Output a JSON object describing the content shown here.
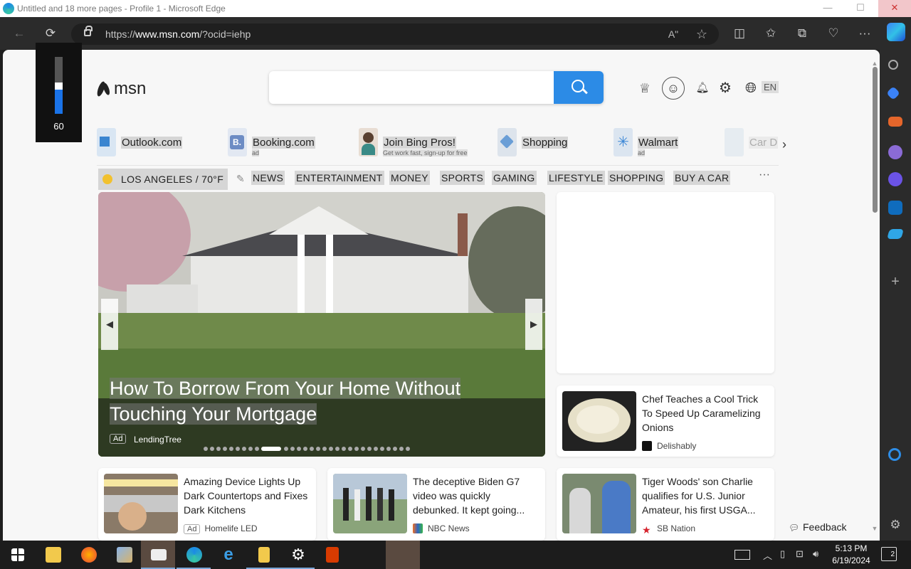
{
  "window": {
    "title": "Untitled and 18 more pages - Profile 1 - Microsoft Edge",
    "controls": {
      "minimize": "—",
      "maximize": "☐",
      "close": "✕"
    }
  },
  "toolbar": {
    "back": "←",
    "refresh": "⟳",
    "url_prefix": "https://",
    "url_domain": "www.msn.com",
    "url_path": "/?ocid=iehp",
    "read_aloud": "Aʺ",
    "favorite": "☆",
    "split": "◫",
    "favorites": "✩",
    "collections": "⧉",
    "health": "♡",
    "more": "···"
  },
  "volume": {
    "level_text": "60",
    "level": 0.6
  },
  "msn": {
    "logo_text": "msn",
    "search_placeholder": "",
    "lang": "EN"
  },
  "header_icons": {
    "rewards": "♕",
    "profile": "☺",
    "bell": "🔔︎",
    "settings": "⚙",
    "globe": "🌐︎"
  },
  "favs": [
    {
      "name": "Outlook.com",
      "sub": "",
      "color": "#5b9bd5"
    },
    {
      "name": "Booking.com",
      "sub": "ad",
      "color": "#8ca6d6"
    },
    {
      "name": "Join Bing Pros!",
      "sub": "Get work fast, sign-up for free",
      "color": "#d8c6b8"
    },
    {
      "name": "Shopping",
      "sub": "",
      "color": "#6a9ed6"
    },
    {
      "name": "Walmart",
      "sub": "ad",
      "color": "#3c87d6"
    },
    {
      "name": "Car D",
      "sub": "",
      "color": "#c9d9e6"
    }
  ],
  "fav_next": "›",
  "weather": {
    "text": "LOS ANGELES / 70°F",
    "edit_icon": "✎"
  },
  "nav": [
    "NEWS",
    "ENTERTAINMENT",
    "MONEY",
    "SPORTS",
    "GAMING",
    "LIFESTYLE",
    "SHOPPING",
    "BUY A CAR"
  ],
  "nav_more": "···",
  "hero": {
    "headline_line1": "How To Borrow From Your Home Without",
    "headline_line2": "Touching Your Mortgage",
    "ad": "Ad",
    "source": "LendingTree",
    "prev": "◀",
    "next": "▶",
    "dot_count": 30,
    "active_dot": 9
  },
  "side_card": {
    "title": "Chef Teaches a Cool Trick To Speed Up Caramelizing Onions",
    "source": "Delishably"
  },
  "cards": [
    {
      "title": "Amazing Device Lights Up Dark Countertops and Fixes Dark Kitchens",
      "ad": "Ad",
      "source": "Homelife LED"
    },
    {
      "title": "The deceptive Biden G7 video was quickly debunked. It kept going...",
      "source": "NBC News"
    },
    {
      "title": "Tiger Woods' son Charlie qualifies for U.S. Junior Amateur, his first USGA...",
      "source": "SB Nation"
    }
  ],
  "feedback": {
    "label": "Feedback",
    "icon": "💬︎"
  },
  "taskbar": {
    "time": "5:13 PM",
    "date": "6/19/2024",
    "notif_count": "2"
  },
  "colors": {
    "accent": "#2c8be6",
    "titlebar_close": "#f2c6ca",
    "walmart": "#3c87d6",
    "sbnation_star": "#d6232d"
  }
}
